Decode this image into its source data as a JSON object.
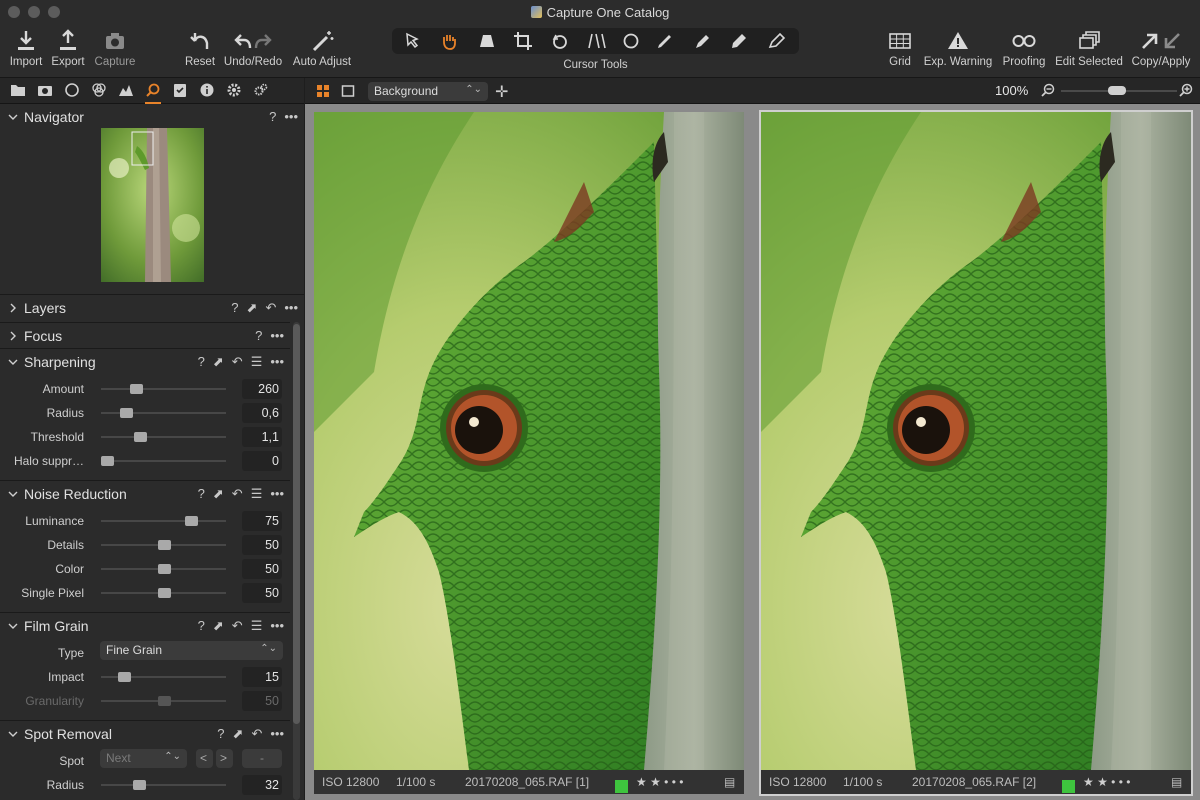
{
  "window": {
    "title": "Capture One Catalog"
  },
  "toolbar": {
    "import": "Import",
    "export": "Export",
    "capture": "Capture",
    "reset": "Reset",
    "undo_redo": "Undo/Redo",
    "auto_adjust": "Auto Adjust",
    "cursor_tools": "Cursor Tools",
    "grid": "Grid",
    "exp_warning": "Exp. Warning",
    "proofing": "Proofing",
    "edit_selected": "Edit Selected",
    "copy_apply": "Copy/Apply"
  },
  "viewbar": {
    "layer_select": "Background",
    "zoom": "100%"
  },
  "colors": {
    "accent": "#e8832a",
    "color_tag": "#3ec43e"
  },
  "panel": {
    "navigator": {
      "title": "Navigator",
      "help": "?",
      "more": "•••"
    },
    "layers": {
      "title": "Layers"
    },
    "focus": {
      "title": "Focus"
    },
    "sharpening": {
      "title": "Sharpening",
      "rows": [
        {
          "label": "Amount",
          "value": "260",
          "fraction": 0.28
        },
        {
          "label": "Radius",
          "value": "0,6",
          "fraction": 0.2
        },
        {
          "label": "Threshold",
          "value": "1,1",
          "fraction": 0.31
        },
        {
          "label": "Halo suppr…",
          "value": "0",
          "fraction": 0.05
        }
      ]
    },
    "noise_reduction": {
      "title": "Noise Reduction",
      "rows": [
        {
          "label": "Luminance",
          "value": "75",
          "fraction": 0.72
        },
        {
          "label": "Details",
          "value": "50",
          "fraction": 0.5
        },
        {
          "label": "Color",
          "value": "50",
          "fraction": 0.5
        },
        {
          "label": "Single Pixel",
          "value": "50",
          "fraction": 0.5
        }
      ]
    },
    "film_grain": {
      "title": "Film Grain",
      "type_label": "Type",
      "type_value": "Fine Grain",
      "rows": [
        {
          "label": "Impact",
          "value": "15",
          "fraction": 0.18
        },
        {
          "label": "Granularity",
          "value": "50",
          "fraction": 0.5
        }
      ]
    },
    "spot_removal": {
      "title": "Spot Removal",
      "spot_label": "Spot",
      "spot_value": "Next",
      "prev": "<",
      "next": ">",
      "remove": "-",
      "radius_label": "Radius",
      "radius_value": "32",
      "radius_fraction": 0.3
    }
  },
  "images": [
    {
      "iso": "ISO 12800",
      "shutter": "1/100 s",
      "filename": "20170208_065.RAF [1]",
      "stars": "★ ★ • • •"
    },
    {
      "iso": "ISO 12800",
      "shutter": "1/100 s",
      "filename": "20170208_065.RAF [2]",
      "stars": "★ ★ • • •"
    }
  ]
}
